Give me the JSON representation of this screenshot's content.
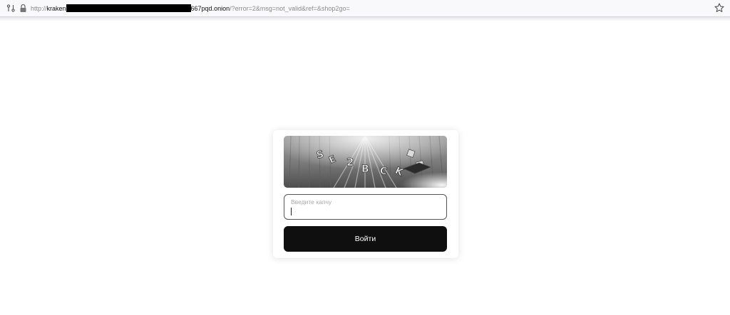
{
  "browser": {
    "url_scheme": "http://",
    "url_host_start": "kraken",
    "url_host_end": "667pqd.onion",
    "url_path": "/?error=2&msg=not_valid&ref=&shop2go=",
    "icons": [
      "permissions-icon",
      "lock-icon",
      "bookmark-star-icon"
    ]
  },
  "login_form": {
    "captcha": {
      "characters": [
        "S",
        "E",
        "2",
        "B",
        "C",
        "K"
      ]
    },
    "input": {
      "placeholder": "Введите капчу",
      "value": ""
    },
    "submit_label": "Войти"
  }
}
